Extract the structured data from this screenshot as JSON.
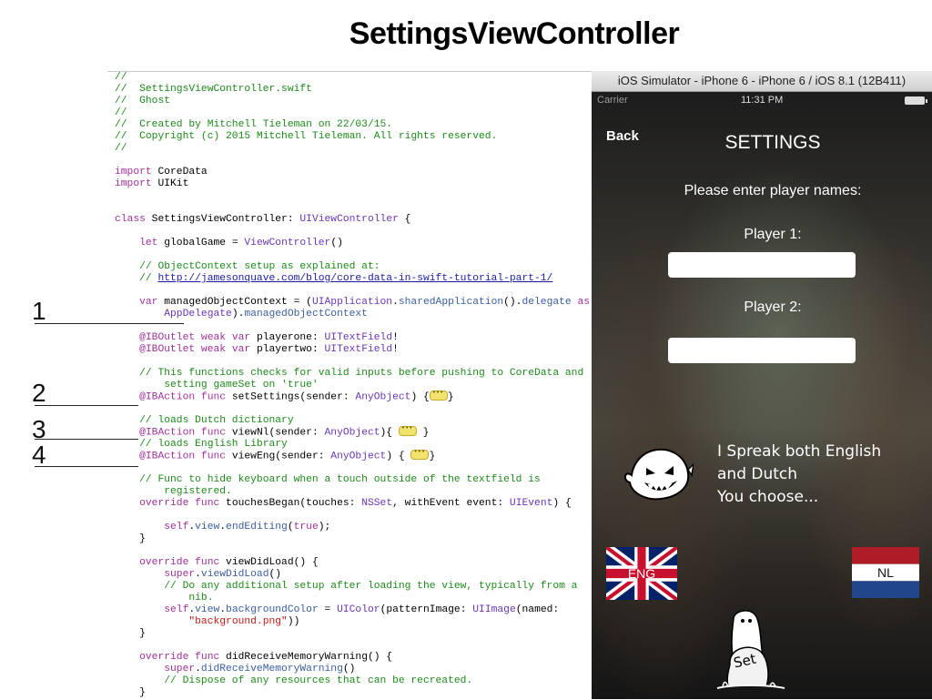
{
  "slide": {
    "title": "SettingsViewController",
    "annotations": [
      "1",
      "2",
      "3",
      "4"
    ]
  },
  "code": {
    "lines": [
      [
        [
          "//",
          "c"
        ]
      ],
      [
        [
          "//  SettingsViewController.swift",
          "c"
        ]
      ],
      [
        [
          "//  Ghost",
          "c"
        ]
      ],
      [
        [
          "//",
          "c"
        ]
      ],
      [
        [
          "//  Created by Mitchell Tieleman on 22/03/15.",
          "c"
        ]
      ],
      [
        [
          "//  Copyright (c) 2015 Mitchell Tieleman. All rights reserved.",
          "c"
        ]
      ],
      [
        [
          "//",
          "c"
        ]
      ],
      [],
      [
        [
          "import",
          "k"
        ],
        [
          " CoreData",
          ""
        ]
      ],
      [
        [
          "import",
          "k"
        ],
        [
          " UIKit",
          ""
        ]
      ],
      [],
      [],
      [
        [
          "class",
          "k"
        ],
        [
          " SettingsViewController: ",
          ""
        ],
        [
          "UIViewController",
          "ty"
        ],
        [
          " {",
          ""
        ]
      ],
      [],
      [
        [
          "    ",
          ""
        ],
        [
          "let",
          "k"
        ],
        [
          " globalGame = ",
          ""
        ],
        [
          "ViewController",
          "ty"
        ],
        [
          "()",
          ""
        ]
      ],
      [],
      [
        [
          "    // ObjectContext setup as explained at:",
          "c"
        ]
      ],
      [
        [
          "    // ",
          "c"
        ],
        [
          "http://jamesonquave.com/blog/core-data-in-swift-tutorial-part-1/",
          "l"
        ]
      ],
      [],
      [
        [
          "    ",
          ""
        ],
        [
          "var",
          "k"
        ],
        [
          " managedObjectContext = (",
          ""
        ],
        [
          "UIApplication",
          "ty"
        ],
        [
          ".",
          ""
        ],
        [
          "sharedApplication",
          "f"
        ],
        [
          "().",
          ""
        ],
        [
          "delegate",
          "f"
        ],
        [
          " ",
          ""
        ],
        [
          "as",
          "k"
        ]
      ],
      [
        [
          "        ",
          ""
        ],
        [
          "AppDelegate",
          "ty"
        ],
        [
          ").",
          ""
        ],
        [
          "managedObjectContext",
          "f"
        ]
      ],
      [],
      [
        [
          "    ",
          ""
        ],
        [
          "@IBOutlet",
          "k"
        ],
        [
          " ",
          ""
        ],
        [
          "weak",
          "k"
        ],
        [
          " ",
          ""
        ],
        [
          "var",
          "k"
        ],
        [
          " playerone: ",
          ""
        ],
        [
          "UITextField",
          "ty"
        ],
        [
          "!",
          ""
        ]
      ],
      [
        [
          "    ",
          ""
        ],
        [
          "@IBOutlet",
          "k"
        ],
        [
          " ",
          ""
        ],
        [
          "weak",
          "k"
        ],
        [
          " ",
          ""
        ],
        [
          "var",
          "k"
        ],
        [
          " playertwo: ",
          ""
        ],
        [
          "UITextField",
          "ty"
        ],
        [
          "!",
          ""
        ]
      ],
      [],
      [
        [
          "    // This functions checks for valid inputs before pushing to CoreData and",
          "c"
        ]
      ],
      [
        [
          "        setting gameSet on 'true'",
          "c"
        ]
      ],
      [
        [
          "    ",
          ""
        ],
        [
          "@IBAction",
          "k"
        ],
        [
          " ",
          ""
        ],
        [
          "func",
          "k"
        ],
        [
          " setSettings(sender: ",
          ""
        ],
        [
          "AnyObject",
          "ty"
        ],
        [
          ") {",
          ""
        ],
        [
          "",
          "fold"
        ],
        [
          "}",
          ""
        ]
      ],
      [],
      [
        [
          "    // loads Dutch dictionary",
          "c"
        ]
      ],
      [
        [
          "    ",
          ""
        ],
        [
          "@IBAction",
          "k"
        ],
        [
          " ",
          ""
        ],
        [
          "func",
          "k"
        ],
        [
          " viewNl(sender: ",
          ""
        ],
        [
          "AnyObject",
          "ty"
        ],
        [
          "){ ",
          ""
        ],
        [
          "",
          "fold"
        ],
        [
          " }",
          ""
        ]
      ],
      [
        [
          "    // loads English Library",
          "c"
        ]
      ],
      [
        [
          "    ",
          ""
        ],
        [
          "@IBAction",
          "k"
        ],
        [
          " ",
          ""
        ],
        [
          "func",
          "k"
        ],
        [
          " viewEng(sender: ",
          ""
        ],
        [
          "AnyObject",
          "ty"
        ],
        [
          ") { ",
          ""
        ],
        [
          "",
          "fold"
        ],
        [
          "}",
          ""
        ]
      ],
      [],
      [
        [
          "    // Func to hide keyboard when a touch outside of the textfield is",
          "c"
        ]
      ],
      [
        [
          "        registered.",
          "c"
        ]
      ],
      [
        [
          "    ",
          ""
        ],
        [
          "override",
          "k"
        ],
        [
          " ",
          ""
        ],
        [
          "func",
          "k"
        ],
        [
          " touchesBegan(touches: ",
          ""
        ],
        [
          "NSSet",
          "ty"
        ],
        [
          ", withEvent event: ",
          ""
        ],
        [
          "UIEvent",
          "ty"
        ],
        [
          ") {",
          ""
        ]
      ],
      [],
      [
        [
          "        ",
          ""
        ],
        [
          "self",
          "k"
        ],
        [
          ".",
          ""
        ],
        [
          "view",
          "f"
        ],
        [
          ".",
          ""
        ],
        [
          "endEditing",
          "f"
        ],
        [
          "(",
          ""
        ],
        [
          "true",
          "k"
        ],
        [
          ");",
          ""
        ]
      ],
      [
        [
          "    }",
          ""
        ]
      ],
      [],
      [
        [
          "    ",
          ""
        ],
        [
          "override",
          "k"
        ],
        [
          " ",
          ""
        ],
        [
          "func",
          "k"
        ],
        [
          " viewDidLoad() {",
          ""
        ]
      ],
      [
        [
          "        ",
          ""
        ],
        [
          "super",
          "k"
        ],
        [
          ".",
          ""
        ],
        [
          "viewDidLoad",
          "f"
        ],
        [
          "()",
          ""
        ]
      ],
      [
        [
          "        // Do any additional setup after loading the view, typically from a",
          "c"
        ]
      ],
      [
        [
          "            nib.",
          "c"
        ]
      ],
      [
        [
          "        ",
          ""
        ],
        [
          "self",
          "k"
        ],
        [
          ".",
          ""
        ],
        [
          "view",
          "f"
        ],
        [
          ".",
          ""
        ],
        [
          "backgroundColor",
          "f"
        ],
        [
          " = ",
          ""
        ],
        [
          "UIColor",
          "ty"
        ],
        [
          "(patternImage: ",
          ""
        ],
        [
          "UIImage",
          "ty"
        ],
        [
          "(named:",
          ""
        ]
      ],
      [
        [
          "            ",
          ""
        ],
        [
          "\"background.png\"",
          "s"
        ],
        [
          "))",
          ""
        ]
      ],
      [
        [
          "    }",
          ""
        ]
      ],
      [],
      [
        [
          "    ",
          ""
        ],
        [
          "override",
          "k"
        ],
        [
          " ",
          ""
        ],
        [
          "func",
          "k"
        ],
        [
          " didReceiveMemoryWarning() {",
          ""
        ]
      ],
      [
        [
          "        ",
          ""
        ],
        [
          "super",
          "k"
        ],
        [
          ".",
          ""
        ],
        [
          "didReceiveMemoryWarning",
          "f"
        ],
        [
          "()",
          ""
        ]
      ],
      [
        [
          "        // Dispose of any resources that can be recreated.",
          "c"
        ]
      ],
      [
        [
          "    }",
          ""
        ]
      ]
    ]
  },
  "simulator": {
    "window_title": "iOS Simulator - iPhone 6 - iPhone 6 / iOS 8.1 (12B411)",
    "status": {
      "carrier": "Carrier",
      "time": "11:31 PM"
    },
    "back_label": "Back",
    "title": "SETTINGS",
    "prompt": "Please enter player names:",
    "player1_label": "Player 1:",
    "player1_value": "",
    "player2_label": "Player 2:",
    "player2_value": "",
    "speech": [
      "I Spreak both English",
      "and Dutch",
      "You choose..."
    ],
    "eng_label": "ENG",
    "nl_label": "NL",
    "set_label": "Set"
  },
  "colors": {
    "comment": "#1d8a1a",
    "keyword": "#a0309e",
    "type": "#6a35b5",
    "function": "#3b5d9e",
    "string": "#c41a16",
    "link": "#1a1aa6"
  }
}
